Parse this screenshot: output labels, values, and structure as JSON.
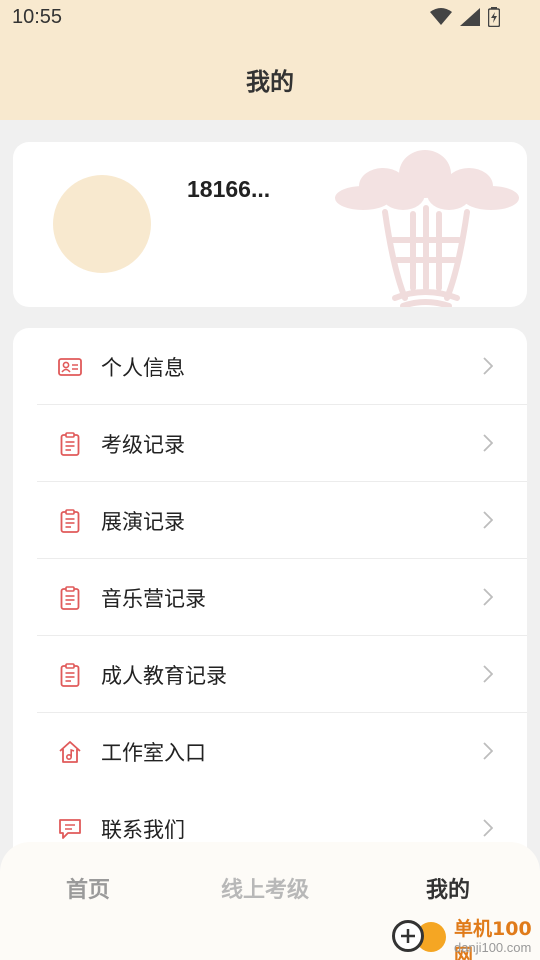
{
  "status_bar": {
    "time": "10:55"
  },
  "header": {
    "title": "我的"
  },
  "profile": {
    "username": "18166..."
  },
  "menu": {
    "items": [
      {
        "label": "个人信息",
        "icon": "id-card-icon"
      },
      {
        "label": "考级记录",
        "icon": "clipboard-icon"
      },
      {
        "label": "展演记录",
        "icon": "clipboard-icon"
      },
      {
        "label": "音乐营记录",
        "icon": "clipboard-icon"
      },
      {
        "label": "成人教育记录",
        "icon": "clipboard-icon"
      },
      {
        "label": "工作室入口",
        "icon": "music-house-icon"
      },
      {
        "label": "联系我们",
        "icon": "chat-icon"
      }
    ]
  },
  "bottom_nav": {
    "tabs": [
      {
        "label": "首页",
        "active": false
      },
      {
        "label": "线上考级",
        "active": false
      },
      {
        "label": "我的",
        "active": true
      }
    ]
  },
  "watermark": {
    "brand": "单机100网",
    "url": "danji100.com"
  },
  "colors": {
    "header_bg": "#f8e9cf",
    "accent_red": "#e05a5a",
    "background": "#f0f0f0"
  }
}
